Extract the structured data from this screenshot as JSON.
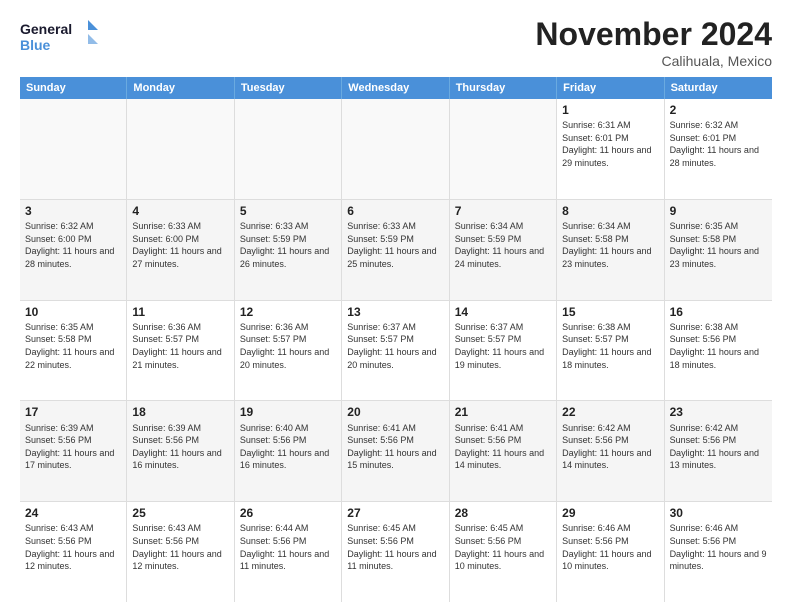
{
  "logo": {
    "line1": "General",
    "line2": "Blue"
  },
  "title": "November 2024",
  "location": "Calihuala, Mexico",
  "weekdays": [
    "Sunday",
    "Monday",
    "Tuesday",
    "Wednesday",
    "Thursday",
    "Friday",
    "Saturday"
  ],
  "rows": [
    [
      {
        "day": "",
        "info": ""
      },
      {
        "day": "",
        "info": ""
      },
      {
        "day": "",
        "info": ""
      },
      {
        "day": "",
        "info": ""
      },
      {
        "day": "",
        "info": ""
      },
      {
        "day": "1",
        "info": "Sunrise: 6:31 AM\nSunset: 6:01 PM\nDaylight: 11 hours and 29 minutes."
      },
      {
        "day": "2",
        "info": "Sunrise: 6:32 AM\nSunset: 6:01 PM\nDaylight: 11 hours and 28 minutes."
      }
    ],
    [
      {
        "day": "3",
        "info": "Sunrise: 6:32 AM\nSunset: 6:00 PM\nDaylight: 11 hours and 28 minutes."
      },
      {
        "day": "4",
        "info": "Sunrise: 6:33 AM\nSunset: 6:00 PM\nDaylight: 11 hours and 27 minutes."
      },
      {
        "day": "5",
        "info": "Sunrise: 6:33 AM\nSunset: 5:59 PM\nDaylight: 11 hours and 26 minutes."
      },
      {
        "day": "6",
        "info": "Sunrise: 6:33 AM\nSunset: 5:59 PM\nDaylight: 11 hours and 25 minutes."
      },
      {
        "day": "7",
        "info": "Sunrise: 6:34 AM\nSunset: 5:59 PM\nDaylight: 11 hours and 24 minutes."
      },
      {
        "day": "8",
        "info": "Sunrise: 6:34 AM\nSunset: 5:58 PM\nDaylight: 11 hours and 23 minutes."
      },
      {
        "day": "9",
        "info": "Sunrise: 6:35 AM\nSunset: 5:58 PM\nDaylight: 11 hours and 23 minutes."
      }
    ],
    [
      {
        "day": "10",
        "info": "Sunrise: 6:35 AM\nSunset: 5:58 PM\nDaylight: 11 hours and 22 minutes."
      },
      {
        "day": "11",
        "info": "Sunrise: 6:36 AM\nSunset: 5:57 PM\nDaylight: 11 hours and 21 minutes."
      },
      {
        "day": "12",
        "info": "Sunrise: 6:36 AM\nSunset: 5:57 PM\nDaylight: 11 hours and 20 minutes."
      },
      {
        "day": "13",
        "info": "Sunrise: 6:37 AM\nSunset: 5:57 PM\nDaylight: 11 hours and 20 minutes."
      },
      {
        "day": "14",
        "info": "Sunrise: 6:37 AM\nSunset: 5:57 PM\nDaylight: 11 hours and 19 minutes."
      },
      {
        "day": "15",
        "info": "Sunrise: 6:38 AM\nSunset: 5:57 PM\nDaylight: 11 hours and 18 minutes."
      },
      {
        "day": "16",
        "info": "Sunrise: 6:38 AM\nSunset: 5:56 PM\nDaylight: 11 hours and 18 minutes."
      }
    ],
    [
      {
        "day": "17",
        "info": "Sunrise: 6:39 AM\nSunset: 5:56 PM\nDaylight: 11 hours and 17 minutes."
      },
      {
        "day": "18",
        "info": "Sunrise: 6:39 AM\nSunset: 5:56 PM\nDaylight: 11 hours and 16 minutes."
      },
      {
        "day": "19",
        "info": "Sunrise: 6:40 AM\nSunset: 5:56 PM\nDaylight: 11 hours and 16 minutes."
      },
      {
        "day": "20",
        "info": "Sunrise: 6:41 AM\nSunset: 5:56 PM\nDaylight: 11 hours and 15 minutes."
      },
      {
        "day": "21",
        "info": "Sunrise: 6:41 AM\nSunset: 5:56 PM\nDaylight: 11 hours and 14 minutes."
      },
      {
        "day": "22",
        "info": "Sunrise: 6:42 AM\nSunset: 5:56 PM\nDaylight: 11 hours and 14 minutes."
      },
      {
        "day": "23",
        "info": "Sunrise: 6:42 AM\nSunset: 5:56 PM\nDaylight: 11 hours and 13 minutes."
      }
    ],
    [
      {
        "day": "24",
        "info": "Sunrise: 6:43 AM\nSunset: 5:56 PM\nDaylight: 11 hours and 12 minutes."
      },
      {
        "day": "25",
        "info": "Sunrise: 6:43 AM\nSunset: 5:56 PM\nDaylight: 11 hours and 12 minutes."
      },
      {
        "day": "26",
        "info": "Sunrise: 6:44 AM\nSunset: 5:56 PM\nDaylight: 11 hours and 11 minutes."
      },
      {
        "day": "27",
        "info": "Sunrise: 6:45 AM\nSunset: 5:56 PM\nDaylight: 11 hours and 11 minutes."
      },
      {
        "day": "28",
        "info": "Sunrise: 6:45 AM\nSunset: 5:56 PM\nDaylight: 11 hours and 10 minutes."
      },
      {
        "day": "29",
        "info": "Sunrise: 6:46 AM\nSunset: 5:56 PM\nDaylight: 11 hours and 10 minutes."
      },
      {
        "day": "30",
        "info": "Sunrise: 6:46 AM\nSunset: 5:56 PM\nDaylight: 11 hours and 9 minutes."
      }
    ]
  ]
}
